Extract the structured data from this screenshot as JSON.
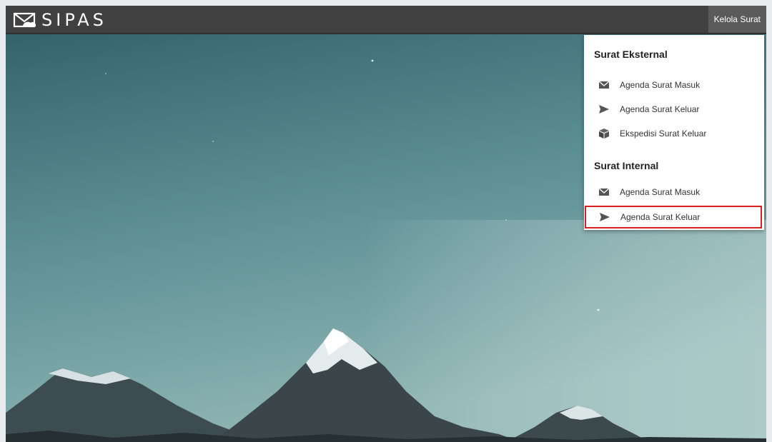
{
  "app": {
    "brand": "SIPAS"
  },
  "header": {
    "menu_button_label": "Kelola Surat"
  },
  "dropdown": {
    "sections": [
      {
        "title": "Surat Eksternal",
        "items": [
          {
            "label": "Agenda Surat Masuk",
            "icon": "envelope-icon"
          },
          {
            "label": "Agenda Surat Keluar",
            "icon": "send-icon"
          },
          {
            "label": "Ekspedisi Surat Keluar",
            "icon": "package-icon"
          }
        ]
      },
      {
        "title": "Surat Internal",
        "items": [
          {
            "label": "Agenda Surat Masuk",
            "icon": "envelope-icon"
          },
          {
            "label": "Agenda Surat Keluar",
            "icon": "send-icon",
            "highlighted": true
          }
        ]
      }
    ]
  },
  "colors": {
    "topbar": "#404040",
    "highlight": "#d62020",
    "sky": "#4f7f86"
  }
}
